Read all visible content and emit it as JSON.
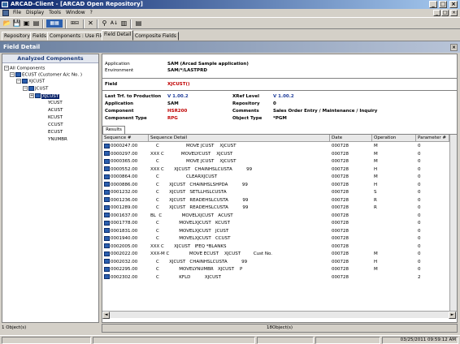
{
  "window": {
    "title": "ARCAD-Client - [ARCAD Open Repository]"
  },
  "menu": [
    "File",
    "Display",
    "Tools",
    "Window",
    "?"
  ],
  "tabs": [
    "Repository",
    "Fields",
    "Components : Use File",
    "Field Detail",
    "Composite Fields"
  ],
  "panel": {
    "title": "Field Detail"
  },
  "tree": {
    "header": "Analyzed Components",
    "root": "All Components",
    "file": "ECUST (Customer A/c No. )",
    "field1": "XJCUST",
    "field2": "JCUST",
    "selected": "XJCUST",
    "children": [
      "YCUST",
      "ACUST",
      "KCUST",
      "CCUST",
      "ECUST",
      "YNUMBR"
    ]
  },
  "info": {
    "application_label": "Application",
    "application": "SAM (Arcad Sample application)",
    "environment_label": "Environment",
    "environment": "SAM/*/LASTPRD",
    "field_label": "Field",
    "field": "XJCUST()",
    "lasttrf_label": "Last Trf. to Production",
    "lasttrf": "V 1.00.2",
    "xref_label": "XRef Level",
    "xref": "V 1.00.2",
    "app2_label": "Application",
    "app2": "SAM",
    "repository_label": "Repository",
    "repository": "0",
    "component_label": "Component",
    "component": "HSR200",
    "comments_label": "Comments",
    "comments": "Sales Order Entry / Maintenance / Inquiry",
    "comptype_label": "Component Type",
    "comptype": "RPG",
    "objtype_label": "Object Type",
    "objtype": "*PGM"
  },
  "results": {
    "tab": "Results",
    "columns": [
      "Sequence #",
      "Sequence Detail",
      "Date",
      "Operation",
      "Parameter #"
    ],
    "rows": [
      {
        "seq": "0000247.00",
        "detail": "    C                   MOVE JCUST    XJCUST",
        "date": "000728",
        "op": "M",
        "param": "0"
      },
      {
        "seq": "0000297.00",
        "detail": "XXX C            MOVELYCUST    XJCUST",
        "date": "000728",
        "op": "M",
        "param": "0"
      },
      {
        "seq": "0000365.00",
        "detail": "    C                   MOVE JCUST    XJCUST",
        "date": "000728",
        "op": "M",
        "param": "0"
      },
      {
        "seq": "0000552.00",
        "detail": "XXX C       XJCUST   CHAINHSLCUSTA          99",
        "date": "000728",
        "op": "H",
        "param": "0"
      },
      {
        "seq": "0000864.00",
        "detail": "    C                   CLEARXJCUST",
        "date": "000728",
        "op": "M",
        "param": "0"
      },
      {
        "seq": "0000886.00",
        "detail": "    C       XJCUST   CHAINHSLSHPDA          99",
        "date": "000728",
        "op": "H",
        "param": "0"
      },
      {
        "seq": "0001232.00",
        "detail": "    C       XJCUST   SETLLHSLCUSTA",
        "date": "000728",
        "op": "S",
        "param": "0"
      },
      {
        "seq": "0001236.00",
        "detail": "    C       XJCUST   READEHSLCUSTA          99",
        "date": "000728",
        "op": "R",
        "param": "0"
      },
      {
        "seq": "0001289.00",
        "detail": "    C       XJCUST   READEHSLCUSTA          99",
        "date": "000728",
        "op": "R",
        "param": "0"
      },
      {
        "seq": "0001637.00",
        "detail": "BL  C              MOVELXJCUST   ACUST",
        "date": "000728",
        "op": "",
        "param": "0"
      },
      {
        "seq": "0001778.00",
        "detail": "    C              MOVELXJCUST   KCUST",
        "date": "000728",
        "op": "",
        "param": "0"
      },
      {
        "seq": "0001831.00",
        "detail": "    C              MOVELXJCUST   JCUST",
        "date": "000728",
        "op": "",
        "param": "0"
      },
      {
        "seq": "0001940.00",
        "detail": "    C              MOVELXJCUST   CCUST",
        "date": "000728",
        "op": "",
        "param": "0"
      },
      {
        "seq": "0002005.00",
        "detail": "XXX C       XJCUST   IFEQ *BLANKS",
        "date": "000728",
        "op": "",
        "param": "0"
      },
      {
        "seq": "0002022.00",
        "detail": "XXX-M C              MOVE ECUST    XJCUST         Cust No.",
        "date": "000728",
        "op": "M",
        "param": "0"
      },
      {
        "seq": "0002032.00",
        "detail": "    C       XJCUST   CHAINHSLCUSTA          99",
        "date": "000728",
        "op": "H",
        "param": "0"
      },
      {
        "seq": "0002295.00",
        "detail": "    C              MOVELYNUMBR   XJCUST    P",
        "date": "000728",
        "op": "M",
        "param": "0"
      },
      {
        "seq": "0002302.00",
        "detail": "    C              KFLD          XJCUST",
        "date": "000728",
        "op": "",
        "param": "2"
      }
    ]
  },
  "status": {
    "left": "1 Object(s)",
    "center": "18Object(s)",
    "datetime": "03/25/2011 09:59:12 AM"
  }
}
